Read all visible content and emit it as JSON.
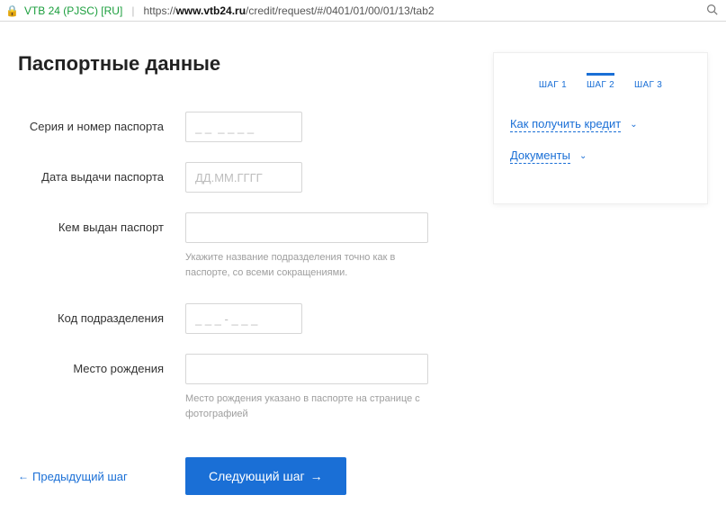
{
  "browser": {
    "cert_name": "VTB 24 (PJSC) [RU]",
    "url_prefix": "https://",
    "url_bold": "www.vtb24.ru",
    "url_rest": "/credit/request/#/0401/01/00/01/13/tab2"
  },
  "page": {
    "title": "Паспортные данные",
    "fields": {
      "series_number": {
        "label": "Серия и номер паспорта",
        "placeholder": "_ _  _ _ _ _"
      },
      "issue_date": {
        "label": "Дата выдачи паспорта",
        "placeholder": "ДД.ММ.ГГГГ"
      },
      "issued_by": {
        "label": "Кем выдан паспорт",
        "hint": "Укажите название подразделения точно как в паспорте, со всеми сокращениями."
      },
      "dept_code": {
        "label": "Код подразделения",
        "placeholder": "_ _ _ - _ _ _"
      },
      "birth_place": {
        "label": "Место рождения",
        "hint": "Место рождения указано в паспорте на странице с фотографией"
      }
    },
    "actions": {
      "back": "Предыдущий шаг",
      "next": "Следующий шаг"
    }
  },
  "sidebar": {
    "steps": [
      "ШАГ 1",
      "ШАГ 2",
      "ШАГ 3"
    ],
    "active_step_index": 1,
    "links": {
      "how_to": "Как получить кредит",
      "documents": "Документы"
    }
  }
}
